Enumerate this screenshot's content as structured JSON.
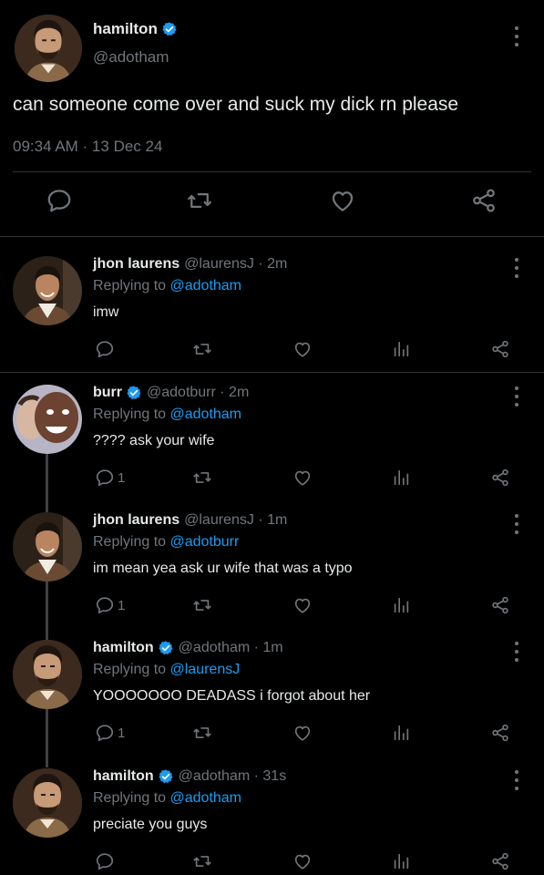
{
  "main_tweet": {
    "name": "hamilton",
    "handle": "@adotham",
    "text": "can someone come over and suck my dick rn please",
    "timestamp": "09:34 AM · 13 Dec 24",
    "actions": [
      "reply-icon",
      "retweet-icon",
      "like-icon",
      "share-icon"
    ]
  },
  "replies": [
    {
      "name": "jhon laurens",
      "meta": "@laurensJ · 2m",
      "replying_prefix": "Replying to",
      "replying_to": "@adotham",
      "text": "imw",
      "reply_count": ""
    },
    {
      "name": "burr",
      "meta": "@adotburr · 2m",
      "replying_prefix": "Replying to",
      "replying_to": "@adotham",
      "text": "???? ask your wife",
      "reply_count": "1"
    },
    {
      "name": "jhon laurens",
      "meta": "@laurensJ · 1m",
      "replying_prefix": "Replying to",
      "replying_to": "@adotburr",
      "text": "im mean yea ask ur wife that was a typo",
      "reply_count": "1"
    },
    {
      "name": "hamilton",
      "meta": "@adotham · 1m",
      "replying_prefix": "Replying to",
      "replying_to": "@laurensJ",
      "text": "YOOOOOOO DEADASS i forgot about her",
      "reply_count": "1"
    },
    {
      "name": "hamilton",
      "meta": "@adotham · 31s",
      "replying_prefix": "Replying to",
      "replying_to": "@adotham",
      "text": "preciate you guys",
      "reply_count": ""
    }
  ],
  "colors": {
    "background": "#000000",
    "text": "#e7e9ea",
    "muted": "#71767b",
    "link": "#1d9bf0",
    "verified": "#1d9bf0",
    "divider": "#2f3336"
  }
}
